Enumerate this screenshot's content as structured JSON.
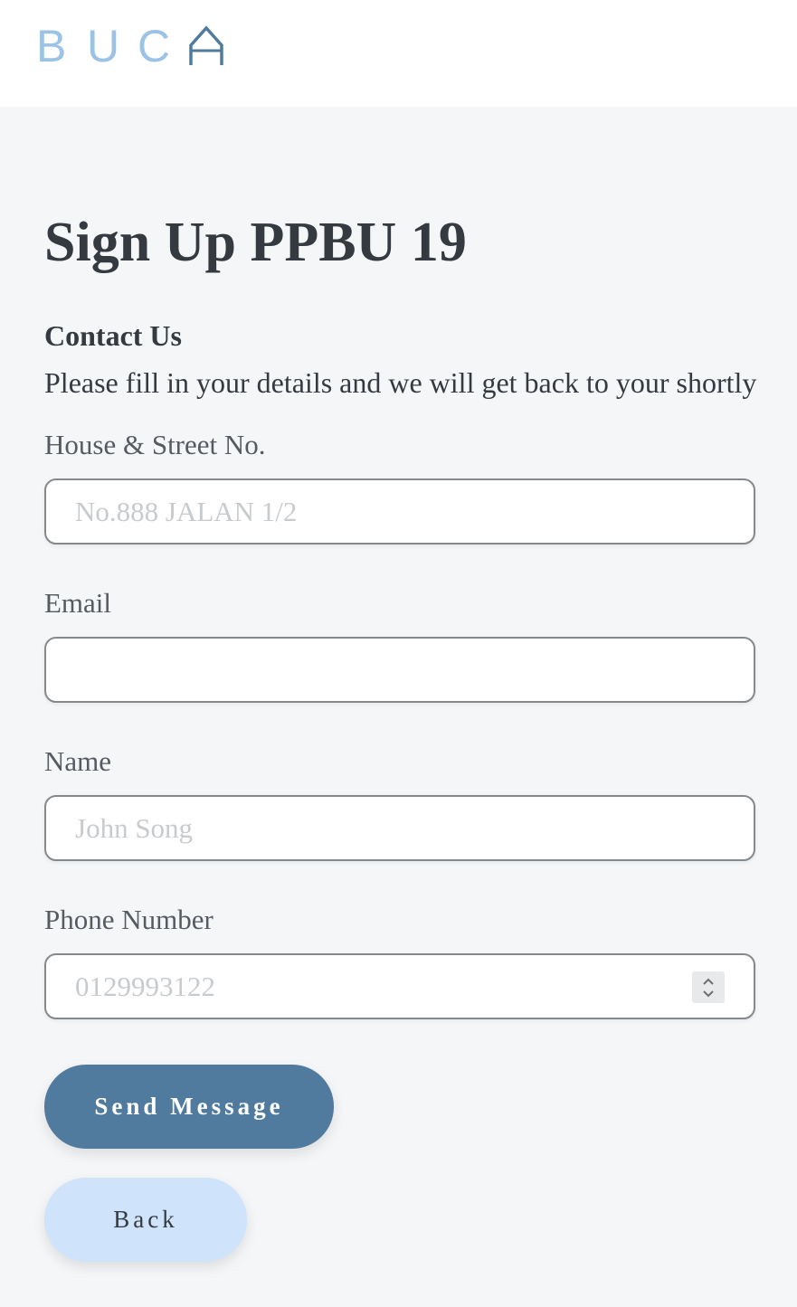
{
  "header": {
    "logo_text": "BUCA",
    "logo_letters": [
      "B",
      "U",
      "C"
    ],
    "logo_colors": {
      "light": "#9cc3e6",
      "dark": "#517b9e"
    }
  },
  "page": {
    "title": "Sign Up PPBU 19",
    "section_title": "Contact Us",
    "intro": "Please fill in your details and we will get back to your shortly"
  },
  "form": {
    "address": {
      "label": "House & Street No.",
      "placeholder": "No.888 JALAN 1/2",
      "value": ""
    },
    "email": {
      "label": "Email",
      "placeholder": "",
      "value": ""
    },
    "name": {
      "label": "Name",
      "placeholder": "John Song",
      "value": ""
    },
    "phone": {
      "label": "Phone Number",
      "placeholder": "0129993122",
      "value": ""
    }
  },
  "buttons": {
    "send_label": "Send Message",
    "back_label": "Back"
  },
  "icons": {
    "spinner": "number-spinner-icon"
  },
  "colors": {
    "background": "#f5f6f8",
    "text": "#343a40",
    "label": "#555b61",
    "send_button": "#517b9e",
    "back_button": "#cfe3fa"
  }
}
